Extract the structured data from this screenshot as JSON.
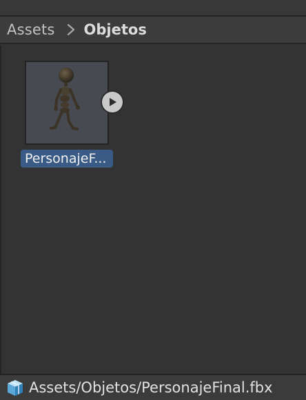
{
  "breadcrumb": {
    "root": "Assets",
    "current": "Objetos"
  },
  "assets": [
    {
      "label": "PersonajeF...",
      "thumbnail_icon": "humanoid-model-icon",
      "has_play_button": true,
      "selected": true
    }
  ],
  "status_bar": {
    "icon": "prefab-model-icon",
    "path": "Assets/Objetos/PersonajeFinal.fbx"
  },
  "colors": {
    "panel_bg": "#333333",
    "selection": "#3a5b86",
    "thumbnail_bg": "#474a50"
  }
}
